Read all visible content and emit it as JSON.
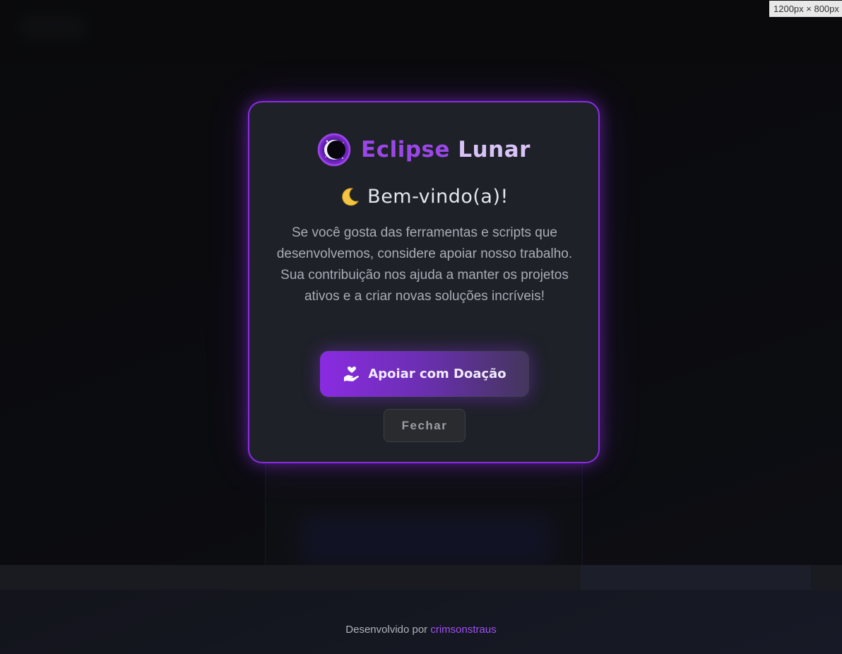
{
  "viewport_badge": "1200px × 800px",
  "modal": {
    "brand_word_1": "Eclipse",
    "brand_word_2": "Lunar",
    "brand_icon": "eclipse-moon-icon",
    "welcome_icon": "crescent-moon-icon",
    "welcome_text": "Bem-vindo(a)!",
    "description": "Se você gosta das ferramentas e scripts que desenvolvemos, considere apoiar nosso trabalho. Sua contribuição nos ajuda a manter os projetos ativos e a criar novas soluções incríveis!",
    "donate_icon": "hand-heart-icon",
    "donate_label": "Apoiar com Doação",
    "close_label": "Fechar"
  },
  "footer": {
    "prefix": "Desenvolvido por",
    "author": "crimsonstraus"
  },
  "colors": {
    "accent": "#8a2be2",
    "brand_primary": "#9b47e8",
    "brand_secondary": "#d7c3f5",
    "modal_bg": "#1e2128",
    "page_bg": "#101114"
  }
}
